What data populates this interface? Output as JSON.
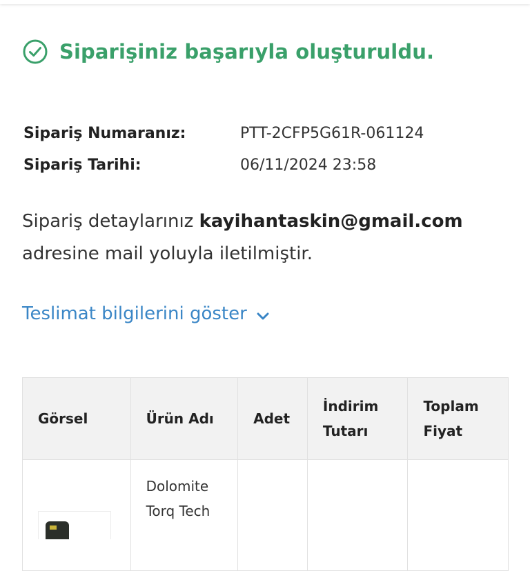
{
  "success": {
    "message": "Siparişiniz başarıyla oluşturuldu.",
    "icon": "check-circle-icon",
    "color": "#3aa06a"
  },
  "order": {
    "number_label": "Sipariş Numaranız:",
    "number_value": "PTT-2CFP5G61R-061124",
    "date_label": "Sipariş Tarihi:",
    "date_value": "06/11/2024 23:58"
  },
  "mail_note": {
    "prefix": "Sipariş detaylarınız ",
    "email": "kayihantaskin@gmail.com",
    "suffix": " adresine mail yoluyla iletilmiştir."
  },
  "delivery": {
    "toggle_label": "Teslimat bilgilerini göster",
    "icon": "chevron-down-icon",
    "color": "#3a86c6"
  },
  "table": {
    "headers": {
      "image": "Görsel",
      "name": "Ürün Adı",
      "qty": "Adet",
      "discount_line1": "İndirim",
      "discount_line2": "Tutarı",
      "total_line1": "Toplam",
      "total_line2": "Fiyat"
    },
    "rows": [
      {
        "name_line1": "Dolomite",
        "name_line2": "Torq Tech",
        "qty": "",
        "discount": "",
        "total": ""
      }
    ]
  }
}
